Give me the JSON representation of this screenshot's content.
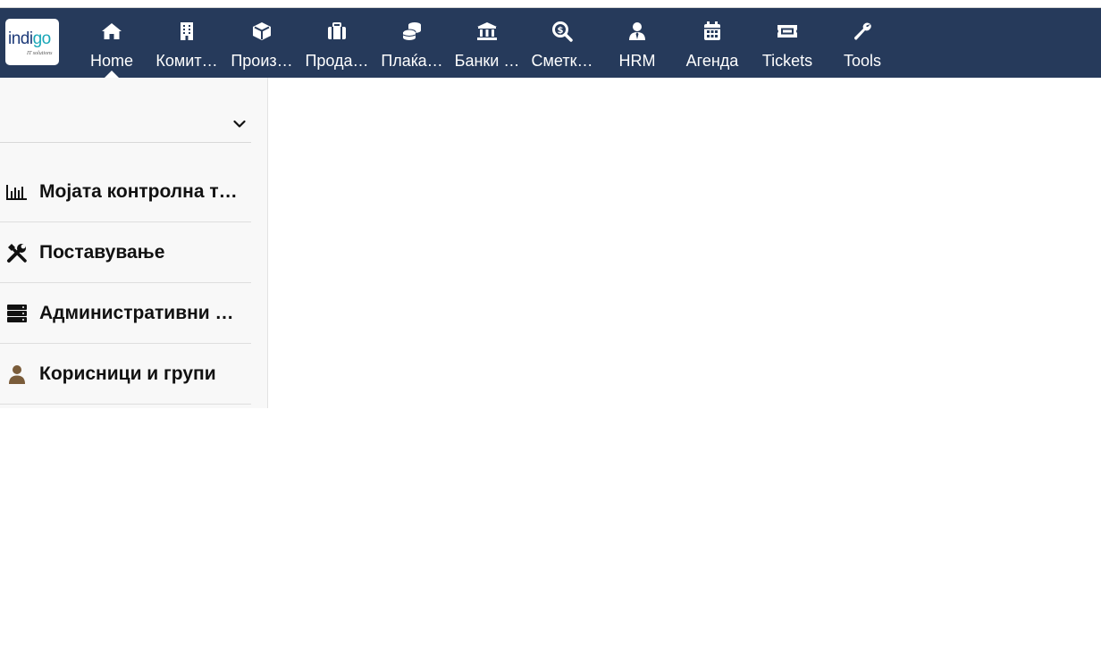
{
  "brand": {
    "logo_word": "indi",
    "logo_accent": "go",
    "logo_tagline": "IT solutions"
  },
  "nav": {
    "items": [
      {
        "label": "Home",
        "icon": "home-icon"
      },
      {
        "label": "Комит…",
        "icon": "building-icon"
      },
      {
        "label": "Произ…",
        "icon": "cube-icon"
      },
      {
        "label": "Прода…",
        "icon": "briefcase-icon"
      },
      {
        "label": "Плаќа…",
        "icon": "coins-icon"
      },
      {
        "label": "Банки …",
        "icon": "bank-icon"
      },
      {
        "label": "Сметк…",
        "icon": "search-dollar-icon"
      },
      {
        "label": "HRM",
        "icon": "user-tie-icon"
      },
      {
        "label": "Агенда",
        "icon": "calendar-icon"
      },
      {
        "label": "Tickets",
        "icon": "ticket-icon"
      },
      {
        "label": "Tools",
        "icon": "wrench-icon"
      }
    ],
    "active": "Home"
  },
  "sidebar": {
    "select_value": "",
    "items": [
      {
        "label": "Мојата контролна т…",
        "icon": "bar-chart-icon"
      },
      {
        "label": "Поставување",
        "icon": "tools-icon"
      },
      {
        "label": "Административни …",
        "icon": "server-icon"
      },
      {
        "label": "Корисници и групи",
        "icon": "user-icon"
      }
    ]
  },
  "colors": {
    "topbar": "#263a5b",
    "user_icon": "#7a5c3a",
    "logo_accent": "#1aa7b8"
  }
}
